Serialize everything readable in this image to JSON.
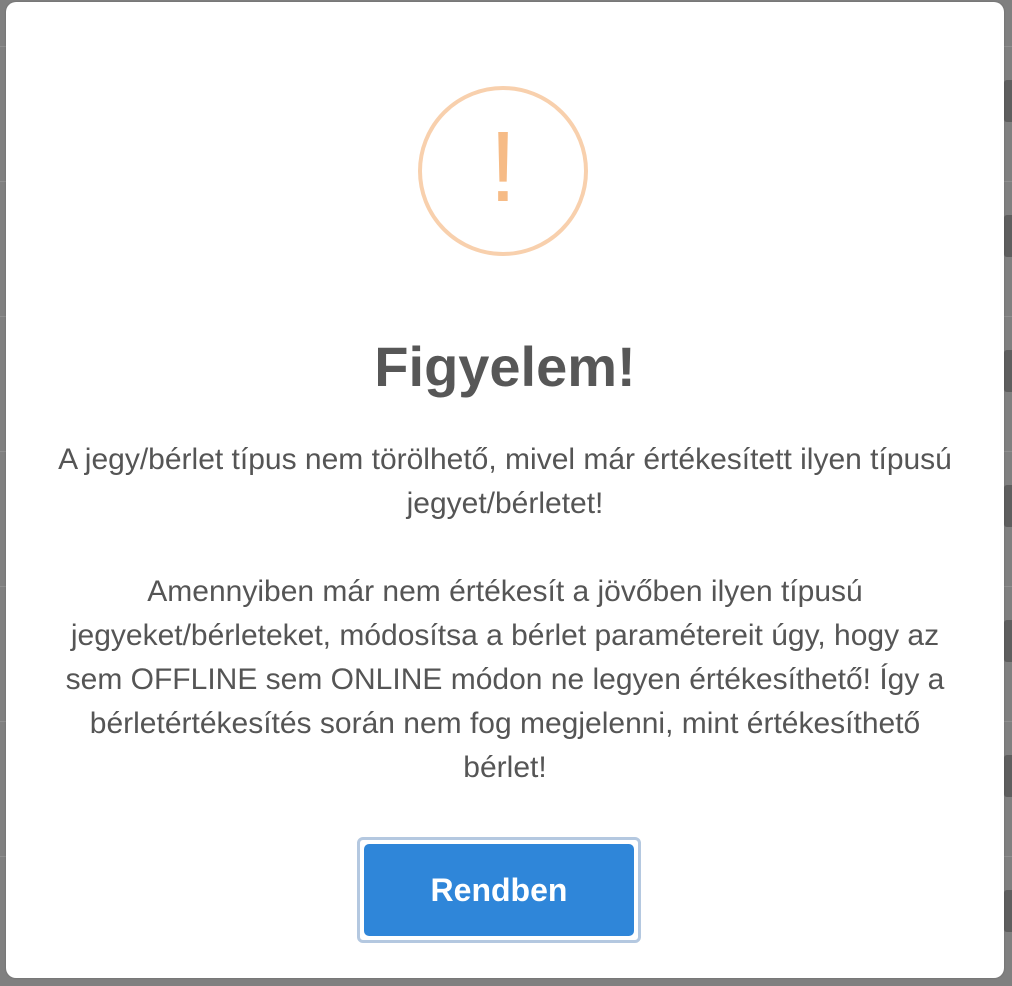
{
  "dialog": {
    "title": "Figyelem!",
    "icon": "warning-exclamation-icon",
    "icon_glyph": "!",
    "message_line1": "A jegy/bérlet típus nem törölhető, mivel már értékesített ilyen típusú jegyet/bérletet!",
    "message_line2": "Amennyiben már nem értékesít a jövőben ilyen típusú jegyeket/bérleteket, módosítsa a bérlet paramétereit úgy, hogy az sem OFFLINE sem ONLINE módon ne legyen értékesíthető! Így a bérletértékesítés során nem fog megjelenni, mint értékesíthető bérlet!",
    "confirm_label": "Rendben"
  },
  "colors": {
    "accent": "#2f86d9",
    "warning": "#f6bb86",
    "text": "#555555"
  }
}
